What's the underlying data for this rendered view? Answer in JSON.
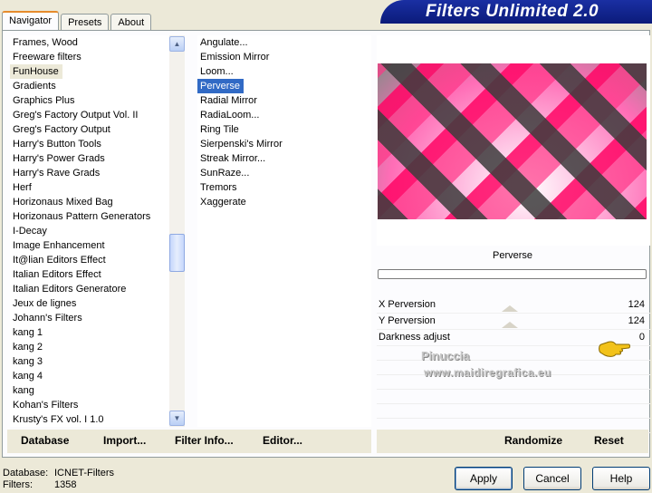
{
  "window": {
    "title": "Filters Unlimited 2.0"
  },
  "tabs": [
    {
      "label": "Navigator",
      "active": true
    },
    {
      "label": "Presets",
      "active": false
    },
    {
      "label": "About",
      "active": false
    }
  ],
  "categories": {
    "selected": "FunHouse",
    "items": [
      "Frames, Wood",
      "Freeware filters",
      "FunHouse",
      "Gradients",
      "Graphics Plus",
      "Greg's Factory Output Vol. II",
      "Greg's Factory Output",
      "Harry's Button Tools",
      "Harry's Power Grads",
      "Harry's Rave Grads",
      "Herf",
      "Horizonaus Mixed Bag",
      "Horizonaus Pattern Generators",
      "I-Decay",
      "Image Enhancement",
      "It@lian Editors Effect",
      "Italian Editors Effect",
      "Italian Editors Generatore",
      "Jeux de lignes",
      "Johann's Filters",
      "kang 1",
      "kang 2",
      "kang 3",
      "kang 4",
      "kang",
      "Kohan's Filters",
      "Krusty's FX vol. I 1.0"
    ]
  },
  "filters": {
    "selected": "Perverse",
    "items": [
      "Angulate...",
      "Emission Mirror",
      "Loom...",
      "Perverse",
      "Radial Mirror",
      "RadiaLoom...",
      "Ring Tile",
      "Sierpenski's Mirror",
      "Streak Mirror...",
      "SunRaze...",
      "Tremors",
      "Xaggerate"
    ]
  },
  "preview": {
    "filter_name": "Perverse"
  },
  "params": [
    {
      "name": "X Perversion",
      "value": "124"
    },
    {
      "name": "Y Perversion",
      "value": "124"
    },
    {
      "name": "Darkness adjust",
      "value": "0"
    }
  ],
  "watermark": {
    "line1": "Pinuccia",
    "line2": "www.maidiregrafica.eu"
  },
  "bottom_links": {
    "database": "Database",
    "import": "Import...",
    "filter_info": "Filter Info...",
    "editor": "Editor...",
    "randomize": "Randomize",
    "reset": "Reset"
  },
  "status": {
    "database_label": "Database:",
    "database_value": "ICNET-Filters",
    "filters_label": "Filters:",
    "filters_value": "1358"
  },
  "buttons": {
    "apply": "Apply",
    "cancel": "Cancel",
    "help": "Help"
  },
  "colors": {
    "selection": "#316ac5",
    "banner": "#0b1b7a",
    "tab_accent": "#e68b2c"
  }
}
